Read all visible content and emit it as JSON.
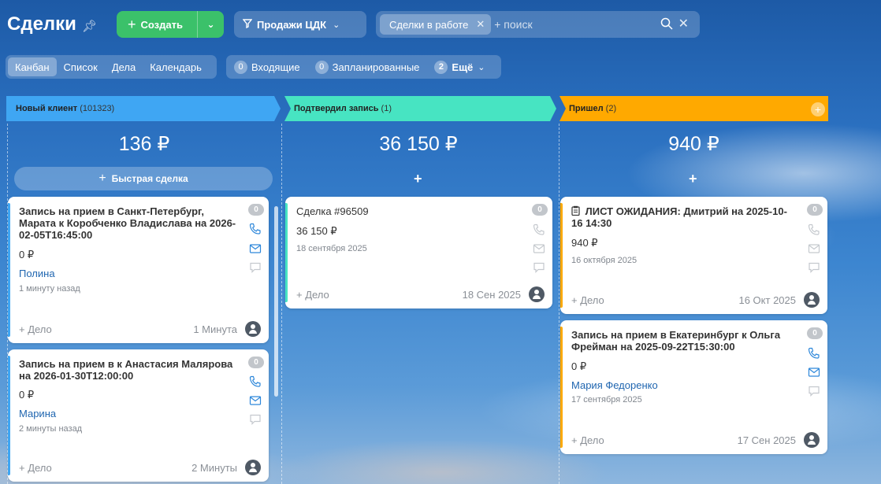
{
  "header": {
    "title": "Сделки",
    "create_label": "Создать",
    "pipeline_label": "Продажи ЦДК",
    "filter_chip": "Сделки в работе",
    "search_placeholder": "+ поиск"
  },
  "views": {
    "items": [
      {
        "label": "Канбан"
      },
      {
        "label": "Список"
      },
      {
        "label": "Дела"
      },
      {
        "label": "Календарь"
      }
    ]
  },
  "counters": {
    "incoming_count": "0",
    "incoming_label": "Входящие",
    "scheduled_count": "0",
    "scheduled_label": "Запланированные",
    "more_count": "2",
    "more_label": "Ещё"
  },
  "quick_deal_label": "Быстрая сделка",
  "colors": {
    "col1": "#3fa6f3",
    "col2": "#47e4c2",
    "col3": "#ffa900",
    "accent_green": "#3bc16a"
  },
  "columns": [
    {
      "title": "Новый клиент",
      "count": "(101323)",
      "total": "136 ₽",
      "cards": [
        {
          "name": "Запись на прием в Санкт-Петербург, Марата к Коробченко Владислава на 2026-02-05T16:45:00",
          "sum": "0 ₽",
          "contact": "Полина",
          "date": "1 минуту назад",
          "badge": "0",
          "add_task": "+ Дело",
          "task_date": "1 Минута"
        },
        {
          "name": "Запись на прием в к Анастасия Малярова на 2026-01-30T12:00:00",
          "sum": "0 ₽",
          "contact": "Марина",
          "date": "2 минуты назад",
          "badge": "0",
          "add_task": "+ Дело",
          "task_date": "2 Минуты"
        }
      ]
    },
    {
      "title": "Подтвердил запись",
      "count": "(1)",
      "total": "36 150 ₽",
      "cards": [
        {
          "name": "Сделка #96509",
          "sum": "36 150 ₽",
          "date": "18 сентября 2025",
          "badge": "0",
          "add_task": "+ Дело",
          "task_date": "18 Сен 2025"
        }
      ]
    },
    {
      "title": "Пришел",
      "count": "(2)",
      "total": "940 ₽",
      "cards": [
        {
          "name": "ЛИСТ ОЖИДАНИЯ: Дмитрий на 2025-10-16 14:30",
          "sum": "940 ₽",
          "date": "16 октября 2025",
          "badge": "0",
          "add_task": "+ Дело",
          "task_date": "16 Окт 2025"
        },
        {
          "name": "Запись на прием в Екатеринбург к Ольга Фрейман на 2025-09-22T15:30:00",
          "sum": "0 ₽",
          "contact": "Мария Федоренко",
          "date": "17 сентября 2025",
          "badge": "0",
          "add_task": "+ Дело",
          "task_date": "17 Сен 2025"
        }
      ]
    }
  ]
}
